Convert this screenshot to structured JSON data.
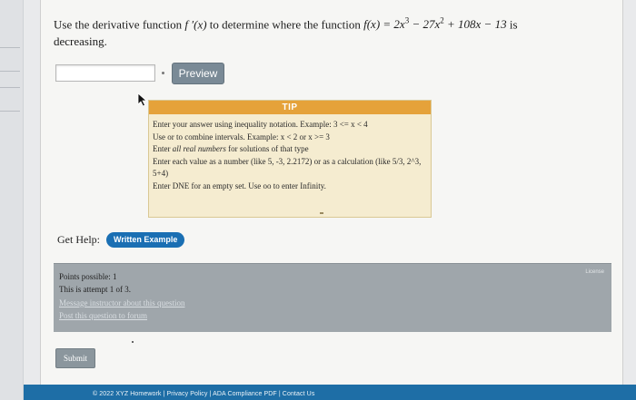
{
  "question": {
    "prefix": "Use the derivative function ",
    "derivative": "f ′(x)",
    "middle": " to determine where the function ",
    "function_lhs": "f(x) = 2x",
    "exp1": "3",
    "term2": " − 27x",
    "exp2": "2",
    "term3": " + 108x − 13",
    "suffix": " is",
    "line2": "decreasing."
  },
  "answer": {
    "value": "",
    "placeholder": ""
  },
  "preview_label": "Preview",
  "tip": {
    "header": "TIP",
    "line1": "Enter your answer using inequality notation. Example: 3 <= x < 4",
    "line2": "Use or to combine intervals. Example: x < 2 or x >= 3",
    "line3_pre": "Enter ",
    "line3_em": "all real numbers",
    "line3_post": " for solutions of that type",
    "line4": "Enter each value as a number (like 5, -3, 2.2172) or as a calculation (like 5/3, 2^3,",
    "line5": "5+4)",
    "line6": "Enter DNE for an empty set. Use oo to enter Infinity."
  },
  "help": {
    "label": "Get Help:",
    "written_example": "Written Example"
  },
  "info": {
    "points": "Points possible: 1",
    "attempt": "This is attempt 1 of 3.",
    "message_link": "Message instructor about this question",
    "forum_link": "Post this question to forum",
    "corner": "License"
  },
  "submit_label": "Submit",
  "footer": "© 2022 XYZ Homework | Privacy Policy | ADA Compliance PDF | Contact Us",
  "colors": {
    "preview": "#7a8a96",
    "tip_header": "#e5a23a",
    "written_example": "#1a6fb3",
    "footer": "#1e6ea6",
    "info_panel": "#9fa6ab"
  }
}
